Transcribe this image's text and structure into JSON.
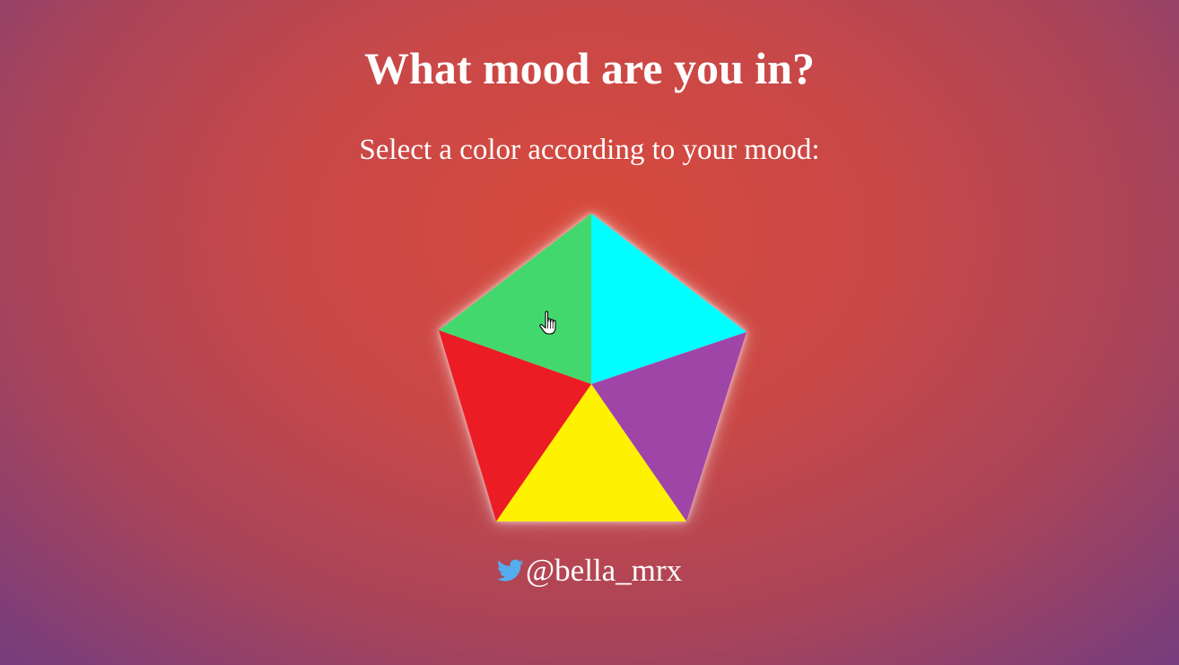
{
  "page": {
    "title": "What mood are you in?",
    "subtitle": "Select a color according to your mood:"
  },
  "mood_wheel": {
    "shape": "pentagon",
    "slices": [
      {
        "name": "green",
        "color": "#43d86e"
      },
      {
        "name": "cyan",
        "color": "#00ffff"
      },
      {
        "name": "purple",
        "color": "#a045a8"
      },
      {
        "name": "yellow",
        "color": "#fff200"
      },
      {
        "name": "red",
        "color": "#ec1c24"
      }
    ]
  },
  "footer": {
    "icon": "twitter-icon",
    "icon_color": "#55acee",
    "handle": "@bella_mrx"
  },
  "colors": {
    "text": "#ffffff",
    "background_center": "#d84a3c",
    "background_edge": "#703c80"
  }
}
